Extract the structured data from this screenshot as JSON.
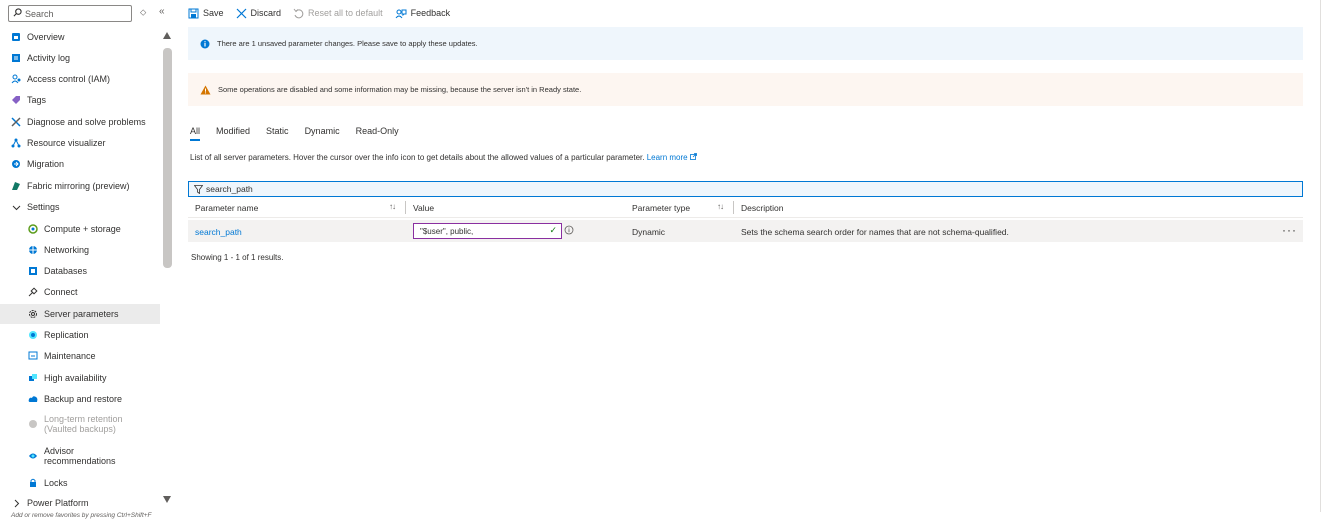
{
  "sidebar": {
    "search_placeholder": "Search",
    "collapse_glyph": "«",
    "items": [
      {
        "label": "Overview",
        "icon": "overview-icon"
      },
      {
        "label": "Activity log",
        "icon": "activity-log-icon"
      },
      {
        "label": "Access control (IAM)",
        "icon": "iam-icon"
      },
      {
        "label": "Tags",
        "icon": "tag-icon"
      },
      {
        "label": "Diagnose and solve problems",
        "icon": "wrench-icon"
      },
      {
        "label": "Resource visualizer",
        "icon": "visualizer-icon"
      },
      {
        "label": "Migration",
        "icon": "migration-icon"
      },
      {
        "label": "Fabric mirroring (preview)",
        "icon": "fabric-icon"
      },
      {
        "label": "Settings",
        "icon": "chevron-down-icon"
      },
      {
        "label": "Compute + storage",
        "icon": "compute-icon"
      },
      {
        "label": "Networking",
        "icon": "network-icon"
      },
      {
        "label": "Databases",
        "icon": "database-icon"
      },
      {
        "label": "Connect",
        "icon": "plug-icon"
      },
      {
        "label": "Server parameters",
        "icon": "gear-icon"
      },
      {
        "label": "Replication",
        "icon": "replication-icon"
      },
      {
        "label": "Maintenance",
        "icon": "maintenance-icon"
      },
      {
        "label": "High availability",
        "icon": "high-availability-icon"
      },
      {
        "label": "Backup and restore",
        "icon": "cloud-backup-icon"
      },
      {
        "label_line1": "Long-term retention",
        "label_line2": "(Vaulted backups)",
        "icon": "vault-icon"
      },
      {
        "label_line1": "Advisor",
        "label_line2": "recommendations",
        "icon": "advisor-icon"
      },
      {
        "label": "Locks",
        "icon": "lock-icon"
      },
      {
        "label": "Power Platform",
        "icon": "chevron-right-icon"
      }
    ],
    "favorites_hint": "Add or remove favorites by pressing Ctrl+Shift+F"
  },
  "toolbar": {
    "save": "Save",
    "discard": "Discard",
    "reset": "Reset all to default",
    "feedback": "Feedback"
  },
  "info_banner": "There are 1 unsaved parameter changes.  Please save to apply these updates.",
  "warning_banner": "Some operations are disabled and some information may be missing, because the server isn't in Ready state.",
  "tabs": [
    "All",
    "Modified",
    "Static",
    "Dynamic",
    "Read-Only"
  ],
  "description": "List of all server parameters. Hover the cursor over the info icon to get details about the allowed values of a particular parameter.",
  "learn_more": "Learn more",
  "filter_value": "search_path",
  "grid": {
    "columns": [
      "Parameter name",
      "Value",
      "Parameter type",
      "Description"
    ],
    "rows": [
      {
        "name": "search_path",
        "value": "\"$user\", public,",
        "type": "Dynamic",
        "description": "Sets the schema search order for names that are not schema-qualified."
      }
    ]
  },
  "showing": "Showing 1 - 1 of 1 results.",
  "colors": {
    "accent": "#0078d4",
    "info_bg": "#eff6fc",
    "warning_bg": "#fdf6f1",
    "warning_icon": "#d47500",
    "selected_bg": "#ebebeb"
  }
}
